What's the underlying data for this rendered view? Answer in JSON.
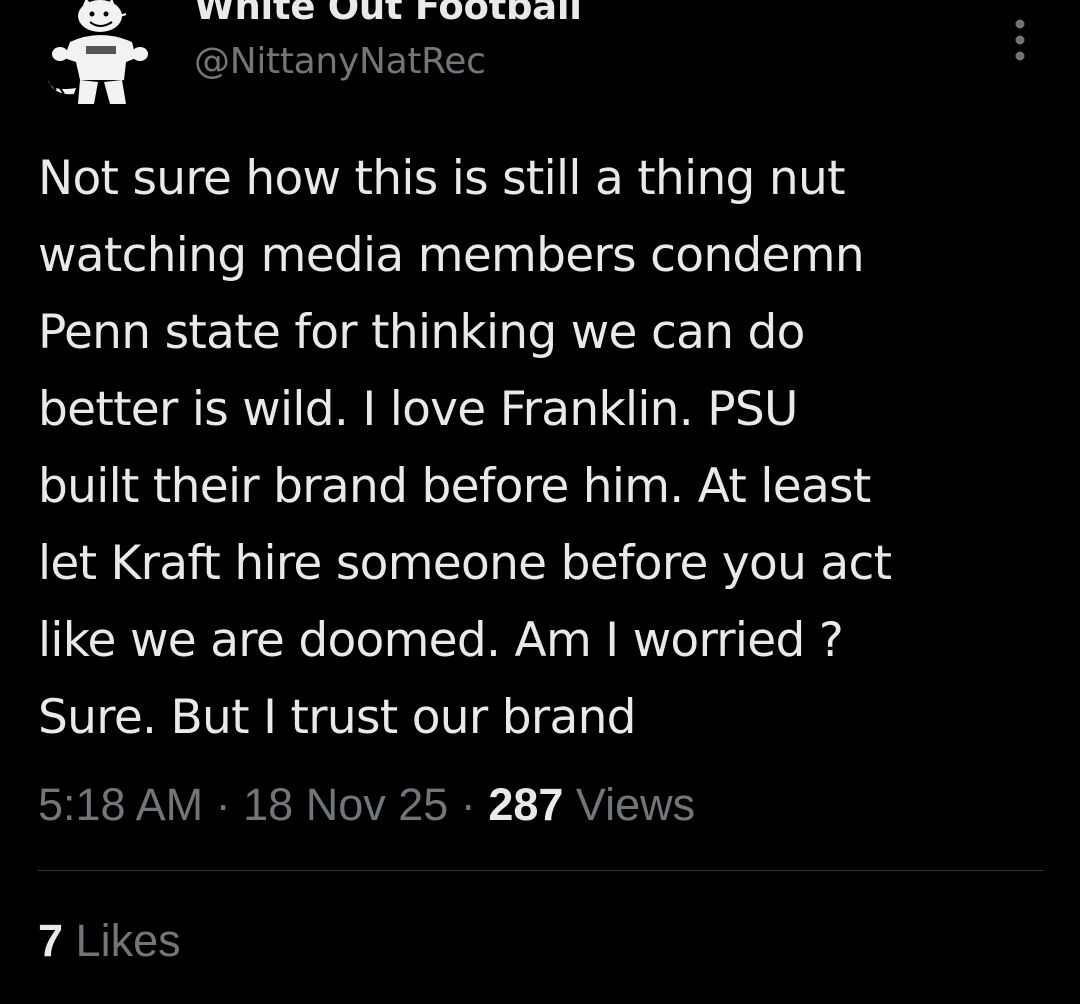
{
  "author": {
    "display_name": "White Out Football",
    "handle": "@NittanyNatRec",
    "avatar_icon": "mascot-cartoon-icon"
  },
  "tweet": {
    "text_lines": [
      "Not sure how this is still a thing nut",
      "watching media members condemn",
      "Penn state for thinking we can do",
      "better is wild. I love Franklin. PSU",
      "built their brand before him. At least",
      "let Kraft hire someone before you act",
      "like we are doomed. Am I worried ?",
      "Sure. But I trust our brand"
    ],
    "time": "5:18 AM",
    "separator": "·",
    "date": "18 Nov 25",
    "views_count": "287",
    "views_label": "Views",
    "likes_count": "7",
    "likes_label": "Likes"
  },
  "colors": {
    "background": "#000000",
    "primary_text": "#e7e9ea",
    "secondary_text": "#71767b",
    "divider": "#2f3336"
  },
  "icons": {
    "more_options": "more-vertical-icon"
  }
}
